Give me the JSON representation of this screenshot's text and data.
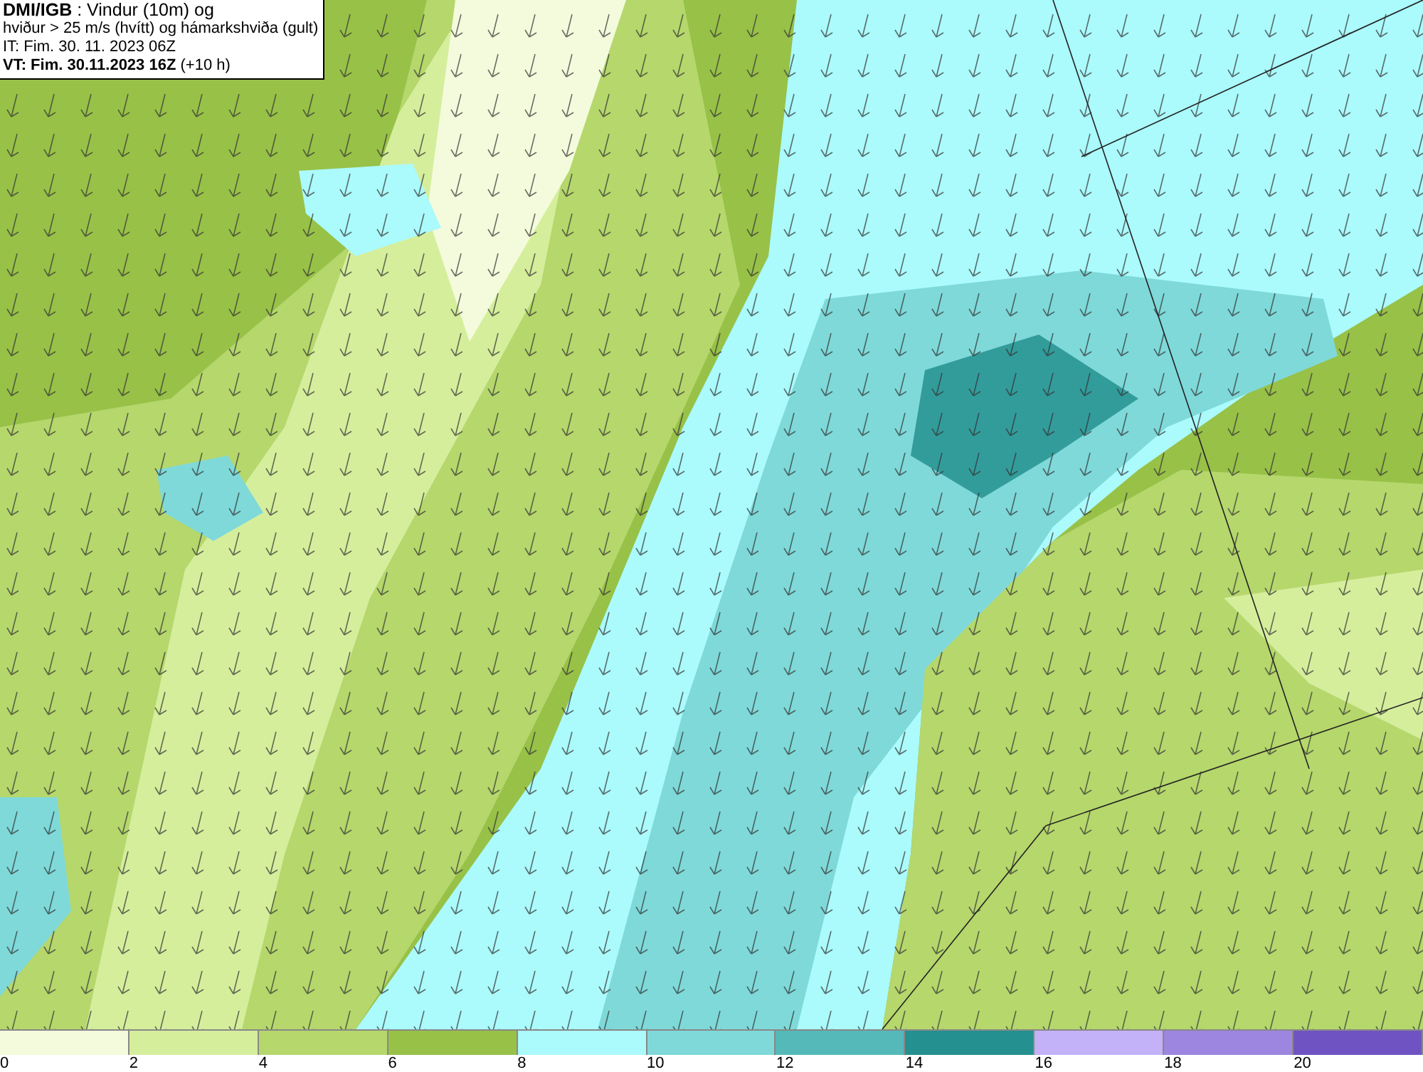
{
  "title_box": {
    "lines": [
      "**DMI/IGB** : Vindur (10m) og",
      "hviður > 25 m/s (hvítt) og hámarkshviða (gult)",
      "IT: Fim. 30. 11. 2023 06Z",
      "**VT: Fim. 30.11.2023 16Z** (+10 h)"
    ]
  },
  "legend": {
    "bins": [
      {
        "label": "0",
        "color": "#f4fbdc"
      },
      {
        "label": "2",
        "color": "#d5ee9c"
      },
      {
        "label": "4",
        "color": "#b5d76c"
      },
      {
        "label": "6",
        "color": "#98c148"
      },
      {
        "label": "8",
        "color": "#abfafc"
      },
      {
        "label": "10",
        "color": "#7fd9d9"
      },
      {
        "label": "12",
        "color": "#55b9b9"
      },
      {
        "label": "14",
        "color": "#24908f"
      },
      {
        "label": "16",
        "color": "#c3b2f7"
      },
      {
        "label": "18",
        "color": "#9c86df"
      },
      {
        "label": "20",
        "color": "#7053c2"
      }
    ]
  }
}
